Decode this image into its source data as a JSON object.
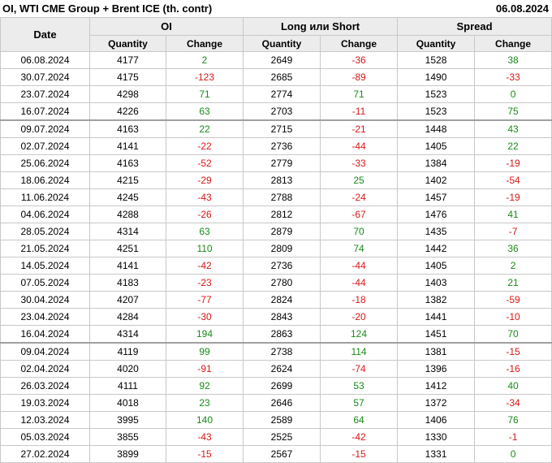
{
  "header": {
    "title": "OI, WTI CME Group + Brent ICE (th. contr)",
    "date": "06.08.2024"
  },
  "columns": {
    "date": "Date",
    "groups": [
      "OI",
      "Long или Short",
      "Spread"
    ],
    "quantity": "Quantity",
    "change": "Change"
  },
  "rows": [
    {
      "date": "06.08.2024",
      "oi_q": "4177",
      "oi_c": "2",
      "ls_q": "2649",
      "ls_c": "-36",
      "sp_q": "1528",
      "sp_c": "38"
    },
    {
      "date": "30.07.2024",
      "oi_q": "4175",
      "oi_c": "-123",
      "ls_q": "2685",
      "ls_c": "-89",
      "sp_q": "1490",
      "sp_c": "-33"
    },
    {
      "date": "23.07.2024",
      "oi_q": "4298",
      "oi_c": "71",
      "ls_q": "2774",
      "ls_c": "71",
      "sp_q": "1523",
      "sp_c": "0"
    },
    {
      "date": "16.07.2024",
      "oi_q": "4226",
      "oi_c": "63",
      "ls_q": "2703",
      "ls_c": "-11",
      "sp_q": "1523",
      "sp_c": "75"
    },
    {
      "date": "09.07.2024",
      "oi_q": "4163",
      "oi_c": "22",
      "ls_q": "2715",
      "ls_c": "-21",
      "sp_q": "1448",
      "sp_c": "43",
      "sep": true
    },
    {
      "date": "02.07.2024",
      "oi_q": "4141",
      "oi_c": "-22",
      "ls_q": "2736",
      "ls_c": "-44",
      "sp_q": "1405",
      "sp_c": "22"
    },
    {
      "date": "25.06.2024",
      "oi_q": "4163",
      "oi_c": "-52",
      "ls_q": "2779",
      "ls_c": "-33",
      "sp_q": "1384",
      "sp_c": "-19"
    },
    {
      "date": "18.06.2024",
      "oi_q": "4215",
      "oi_c": "-29",
      "ls_q": "2813",
      "ls_c": "25",
      "sp_q": "1402",
      "sp_c": "-54"
    },
    {
      "date": "11.06.2024",
      "oi_q": "4245",
      "oi_c": "-43",
      "ls_q": "2788",
      "ls_c": "-24",
      "sp_q": "1457",
      "sp_c": "-19"
    },
    {
      "date": "04.06.2024",
      "oi_q": "4288",
      "oi_c": "-26",
      "ls_q": "2812",
      "ls_c": "-67",
      "sp_q": "1476",
      "sp_c": "41"
    },
    {
      "date": "28.05.2024",
      "oi_q": "4314",
      "oi_c": "63",
      "ls_q": "2879",
      "ls_c": "70",
      "sp_q": "1435",
      "sp_c": "-7"
    },
    {
      "date": "21.05.2024",
      "oi_q": "4251",
      "oi_c": "110",
      "ls_q": "2809",
      "ls_c": "74",
      "sp_q": "1442",
      "sp_c": "36"
    },
    {
      "date": "14.05.2024",
      "oi_q": "4141",
      "oi_c": "-42",
      "ls_q": "2736",
      "ls_c": "-44",
      "sp_q": "1405",
      "sp_c": "2"
    },
    {
      "date": "07.05.2024",
      "oi_q": "4183",
      "oi_c": "-23",
      "ls_q": "2780",
      "ls_c": "-44",
      "sp_q": "1403",
      "sp_c": "21"
    },
    {
      "date": "30.04.2024",
      "oi_q": "4207",
      "oi_c": "-77",
      "ls_q": "2824",
      "ls_c": "-18",
      "sp_q": "1382",
      "sp_c": "-59"
    },
    {
      "date": "23.04.2024",
      "oi_q": "4284",
      "oi_c": "-30",
      "ls_q": "2843",
      "ls_c": "-20",
      "sp_q": "1441",
      "sp_c": "-10"
    },
    {
      "date": "16.04.2024",
      "oi_q": "4314",
      "oi_c": "194",
      "ls_q": "2863",
      "ls_c": "124",
      "sp_q": "1451",
      "sp_c": "70"
    },
    {
      "date": "09.04.2024",
      "oi_q": "4119",
      "oi_c": "99",
      "ls_q": "2738",
      "ls_c": "114",
      "sp_q": "1381",
      "sp_c": "-15",
      "sep": true
    },
    {
      "date": "02.04.2024",
      "oi_q": "4020",
      "oi_c": "-91",
      "ls_q": "2624",
      "ls_c": "-74",
      "sp_q": "1396",
      "sp_c": "-16"
    },
    {
      "date": "26.03.2024",
      "oi_q": "4111",
      "oi_c": "92",
      "ls_q": "2699",
      "ls_c": "53",
      "sp_q": "1412",
      "sp_c": "40"
    },
    {
      "date": "19.03.2024",
      "oi_q": "4018",
      "oi_c": "23",
      "ls_q": "2646",
      "ls_c": "57",
      "sp_q": "1372",
      "sp_c": "-34"
    },
    {
      "date": "12.03.2024",
      "oi_q": "3995",
      "oi_c": "140",
      "ls_q": "2589",
      "ls_c": "64",
      "sp_q": "1406",
      "sp_c": "76"
    },
    {
      "date": "05.03.2024",
      "oi_q": "3855",
      "oi_c": "-43",
      "ls_q": "2525",
      "ls_c": "-42",
      "sp_q": "1330",
      "sp_c": "-1"
    },
    {
      "date": "27.02.2024",
      "oi_q": "3899",
      "oi_c": "-15",
      "ls_q": "2567",
      "ls_c": "-15",
      "sp_q": "1331",
      "sp_c": "0"
    }
  ],
  "colors": {
    "positive": "#1a8a1a",
    "negative": "#d81818",
    "header_bg": "#ececec"
  }
}
